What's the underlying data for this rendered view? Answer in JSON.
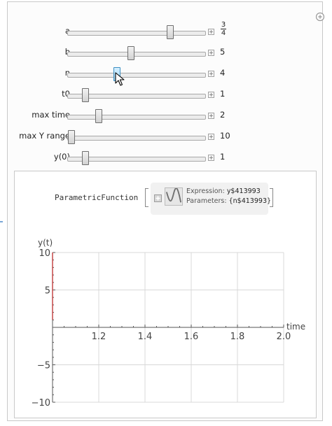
{
  "manipulate": {
    "controls": [
      {
        "id": "a",
        "label": "a",
        "value_num": "3",
        "value_den": "4",
        "fraction": true,
        "thumb_pos": 0.758,
        "active": false
      },
      {
        "id": "b",
        "label": "b",
        "value": "5",
        "thumb_pos": 0.455,
        "active": false
      },
      {
        "id": "n",
        "label": "n",
        "value": "4",
        "thumb_pos": 0.348,
        "active": true
      },
      {
        "id": "t0",
        "label": "t0",
        "value": "1",
        "thumb_pos": 0.106,
        "active": false
      },
      {
        "id": "max-time",
        "label": "max time",
        "value": "2",
        "thumb_pos": 0.21,
        "active": false
      },
      {
        "id": "max-y-range",
        "label": "max Y range",
        "value": "10",
        "thumb_pos": 0.0,
        "active": false
      },
      {
        "id": "y0",
        "label": "y(0)",
        "value": "1",
        "thumb_pos": 0.106,
        "active": false
      }
    ]
  },
  "output": {
    "function_head": "ParametricFunction",
    "expression_label": "Expression:",
    "expression_value": "y$413993",
    "parameters_label": "Parameters:",
    "parameters_value": "{n$413993}"
  },
  "chart_data": {
    "type": "line",
    "title": "",
    "xlabel": "time",
    "ylabel": "y(t)",
    "xlim": [
      1.0,
      2.0
    ],
    "ylim": [
      -10,
      10
    ],
    "x_ticks": [
      1.2,
      1.4,
      1.6,
      1.8,
      2.0
    ],
    "x_tick_labels": [
      "1.2",
      "1.4",
      "1.6",
      "1.8",
      "2.0"
    ],
    "y_ticks": [
      -10,
      -5,
      5,
      10
    ],
    "y_tick_labels": [
      "−10",
      "−5",
      "5",
      "10"
    ],
    "grid": true,
    "series": [
      {
        "color": "#c23b3b",
        "x": [
          1.0,
          1.0
        ],
        "y": [
          1,
          10
        ]
      }
    ]
  },
  "colors": {
    "curve": "#c23b3b",
    "grid": "#d8d8d8",
    "axis": "#555555",
    "thumb_active": "#9ed6f5"
  }
}
